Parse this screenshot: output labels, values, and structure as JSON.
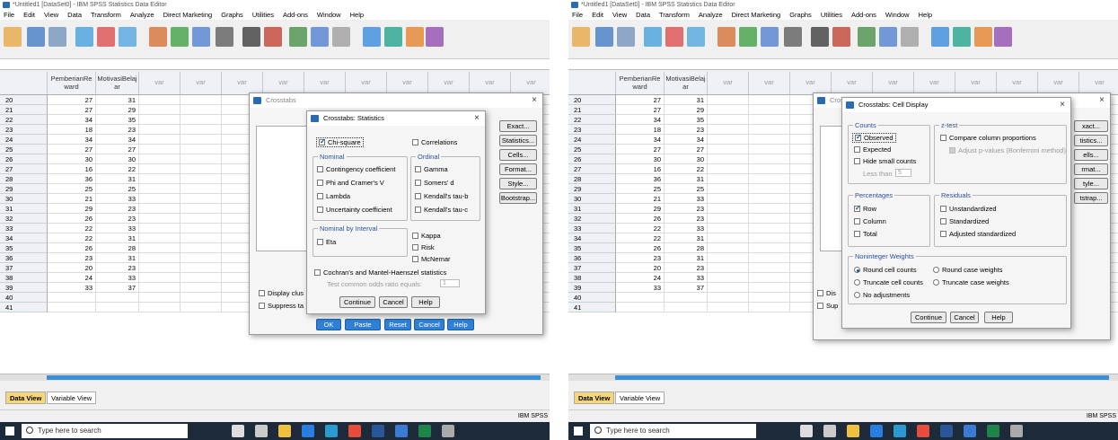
{
  "window_title": "*Untitled1 [DataSet0] - IBM SPSS Statistics Data Editor",
  "menu": [
    "File",
    "Edit",
    "View",
    "Data",
    "Transform",
    "Analyze",
    "Direct Marketing",
    "Graphs",
    "Utilities",
    "Add-ons",
    "Window",
    "Help"
  ],
  "columns": {
    "col1": "PemberianRe ward",
    "col2": "MotivasiBelaj ar",
    "var": "var"
  },
  "rows": [
    {
      "n": "20",
      "a": "27",
      "b": "31"
    },
    {
      "n": "21",
      "a": "27",
      "b": "29"
    },
    {
      "n": "22",
      "a": "34",
      "b": "35"
    },
    {
      "n": "23",
      "a": "18",
      "b": "23"
    },
    {
      "n": "24",
      "a": "34",
      "b": "34"
    },
    {
      "n": "25",
      "a": "27",
      "b": "27"
    },
    {
      "n": "26",
      "a": "30",
      "b": "30"
    },
    {
      "n": "27",
      "a": "16",
      "b": "22"
    },
    {
      "n": "28",
      "a": "36",
      "b": "31"
    },
    {
      "n": "29",
      "a": "25",
      "b": "25"
    },
    {
      "n": "30",
      "a": "21",
      "b": "33"
    },
    {
      "n": "31",
      "a": "29",
      "b": "23"
    },
    {
      "n": "32",
      "a": "26",
      "b": "23"
    },
    {
      "n": "33",
      "a": "22",
      "b": "33"
    },
    {
      "n": "34",
      "a": "22",
      "b": "31"
    },
    {
      "n": "35",
      "a": "26",
      "b": "28"
    },
    {
      "n": "36",
      "a": "23",
      "b": "31"
    },
    {
      "n": "37",
      "a": "20",
      "b": "23"
    },
    {
      "n": "38",
      "a": "24",
      "b": "33"
    },
    {
      "n": "39",
      "a": "33",
      "b": "37"
    },
    {
      "n": "40",
      "a": "",
      "b": ""
    },
    {
      "n": "41",
      "a": "",
      "b": ""
    }
  ],
  "tabs": {
    "data_view": "Data View",
    "variable_view": "Variable View"
  },
  "status": "IBM SPSS",
  "taskbar": {
    "search_placeholder": "Type here to search"
  },
  "crosstabs": {
    "title": "Crosstabs",
    "side_buttons": [
      "Exact...",
      "Statistics...",
      "Cells...",
      "Format...",
      "Style...",
      "Bootstrap..."
    ],
    "display_clustered": "Display clus",
    "suppress_tables": "Suppress ta",
    "bottom_buttons": [
      "OK",
      "Paste",
      "Reset",
      "Cancel",
      "Help"
    ]
  },
  "statistics": {
    "title": "Crosstabs: Statistics",
    "chi_square": "Chi-square",
    "correlations": "Correlations",
    "nominal_legend": "Nominal",
    "nominal": [
      "Contingency coefficient",
      "Phi and Cramer's V",
      "Lambda",
      "Uncertainty coefficient"
    ],
    "ordinal_legend": "Ordinal",
    "ordinal": [
      "Gamma",
      "Somers' d",
      "Kendall's tau-b",
      "Kendall's tau-c"
    ],
    "interval_legend": "Nominal by Interval",
    "eta": "Eta",
    "kappa": "Kappa",
    "risk": "Risk",
    "mcnemar": "McNemar",
    "cochran": "Cochran's and Mantel-Haenszel statistics",
    "test_ratio": "Test common odds ratio equals:",
    "test_value": "1",
    "continue": "Continue",
    "cancel": "Cancel",
    "help": "Help"
  },
  "cell_display": {
    "title": "Crosstabs: Cell Display",
    "counts_legend": "Counts",
    "observed": "Observed",
    "expected": "Expected",
    "hide_small": "Hide small counts",
    "less_than": "Less than",
    "less_value": "5",
    "ztest_legend": "z-test",
    "compare": "Compare column proportions",
    "adjust": "Adjust p-values (Bonferroni method)",
    "percentages_legend": "Percentages",
    "row": "Row",
    "column": "Column",
    "total": "Total",
    "residuals_legend": "Residuals",
    "unstandardized": "Unstandardized",
    "standardized": "Standardized",
    "adjusted": "Adjusted standardized",
    "nonint_legend": "Noninteger Weights",
    "round_cell": "Round cell counts",
    "round_case": "Round case weights",
    "truncate_cell": "Truncate cell counts",
    "truncate_case": "Truncate case weights",
    "no_adjust": "No adjustments",
    "continue": "Continue",
    "cancel": "Cancel",
    "help": "Help",
    "back_side_buttons": [
      "xact...",
      "tistics...",
      "ells...",
      "rmat...",
      "tyle...",
      "tstrap..."
    ],
    "back_dis": "Dis",
    "back_sup": "Sup",
    "back_title": "Cros"
  }
}
